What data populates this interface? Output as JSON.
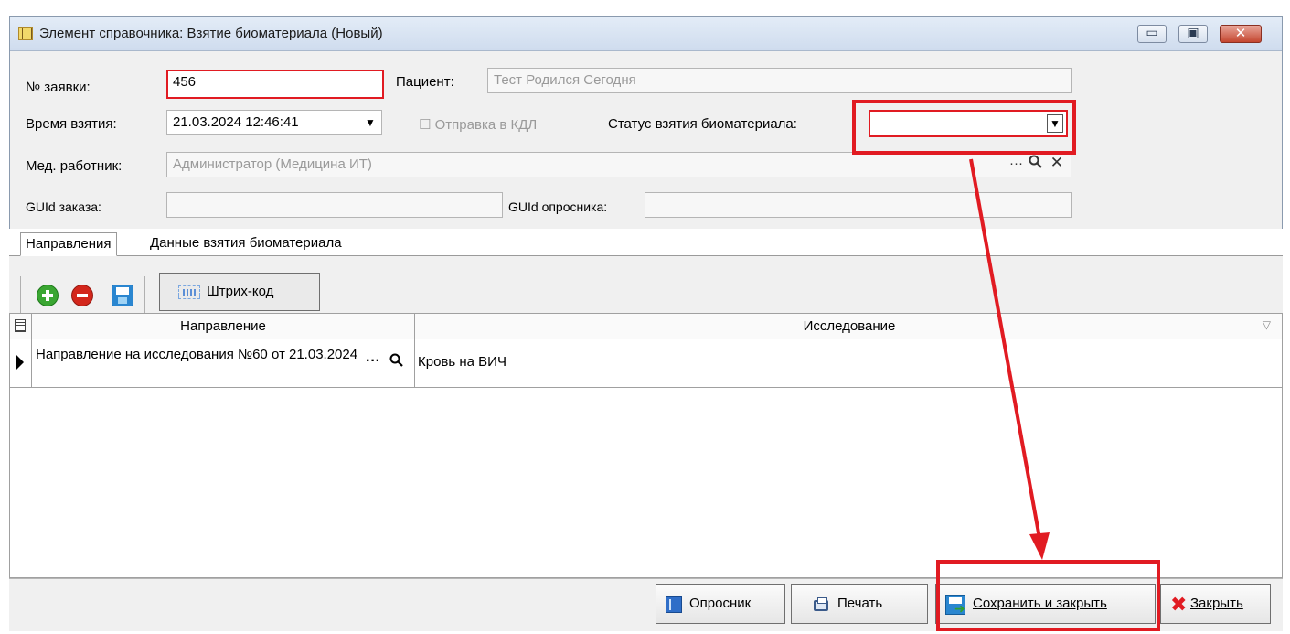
{
  "window": {
    "title": "Элемент справочника: Взятие биоматериала (Новый)",
    "controls": {
      "minimize": "▭",
      "maximize": "▣",
      "close": "✕"
    }
  },
  "form": {
    "order_no_label": "№ заявки:",
    "order_no_value": "456",
    "patient_label": "Пациент:",
    "patient_value": "Тест Родился Сегодня",
    "time_label": "Время взятия:",
    "time_value": "21.03.2024 12:46:41",
    "send_kdl_label": "Отправка в КДЛ",
    "status_label": "Статус взятия биоматериала:",
    "status_value": "",
    "med_worker_label": "Мед. работник:",
    "med_worker_value": "Администратор (Медицина ИТ)",
    "guid_order_label": "GUId заказа:",
    "guid_order_value": "",
    "guid_survey_label": "GUId опросника:",
    "guid_survey_value": ""
  },
  "tabs": [
    {
      "label": "Направления",
      "active": true
    },
    {
      "label": "Данные взятия биоматериала",
      "active": false
    }
  ],
  "toolbar": {
    "barcode_label": "Штрих-код"
  },
  "grid": {
    "columns": [
      "Направление",
      "Исследование"
    ],
    "rows": [
      {
        "direction": "Направление на исследования №60 от 21.03.2024",
        "research": "Кровь на ВИЧ"
      }
    ]
  },
  "footer": {
    "survey_label": "Опросник",
    "print_label": "Печать",
    "save_close_label": "Сохранить и закрыть",
    "close_label": "Закрыть"
  },
  "icons": {
    "add": "add-icon",
    "delete": "delete-icon",
    "save": "save-icon",
    "barcode": "barcode-icon"
  },
  "colors": {
    "annotation_red": "#e11b22",
    "titlebar": "#cfdcee",
    "window_bg": "#f0f0f0"
  }
}
